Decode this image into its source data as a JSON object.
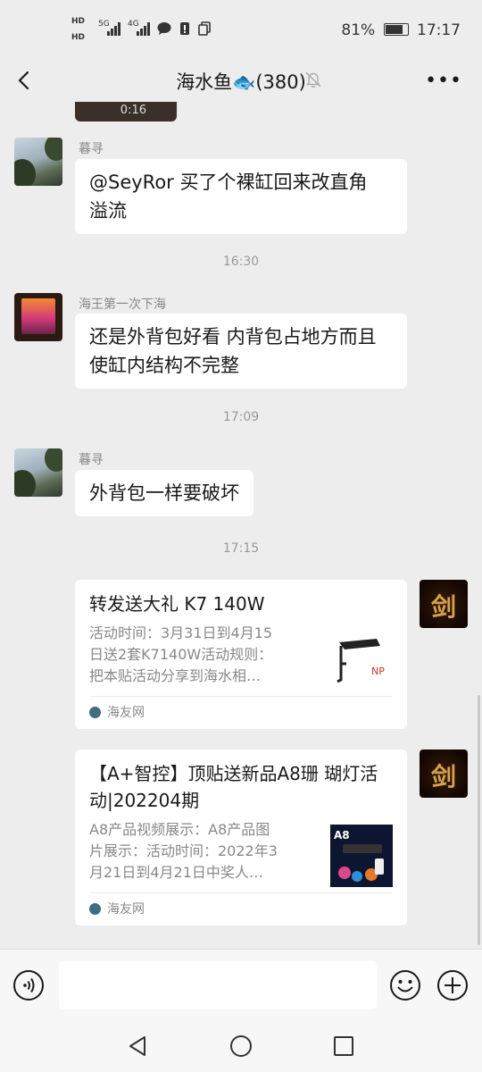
{
  "status_bar": {
    "hd1": "HD",
    "hd2": "HD",
    "net1": "5G",
    "net2": "4G",
    "battery": "81%",
    "time": "17:17"
  },
  "header": {
    "title": "海水鱼🐟(380)",
    "back_icon": "chevron-left-icon",
    "mute_icon": "bell-off-icon",
    "more_label": "•••"
  },
  "messages": [
    {
      "type": "video",
      "duration": "0:16"
    },
    {
      "type": "text",
      "sender": "暮寻",
      "avatar": "tree",
      "lines": [
        "@SeyRor  买了个裸缸回来改直角",
        "溢流"
      ]
    },
    {
      "type": "time",
      "text": "16:30"
    },
    {
      "type": "text",
      "sender": "海王第一次下海",
      "avatar": "sea",
      "lines": [
        "还是外背包好看 内背包占地方而且",
        "使缸内结构不完整"
      ]
    },
    {
      "type": "time",
      "text": "17:09"
    },
    {
      "type": "text",
      "sender": "暮寻",
      "avatar": "tree",
      "lines": [
        "外背包一样要破坏"
      ]
    },
    {
      "type": "time",
      "text": "17:15"
    },
    {
      "type": "card",
      "title": "转发送大礼 K7 140W",
      "desc": [
        "活动时间：3月31日到4月15",
        "日送2套K7140W活动规则：",
        "把本贴活动分享到海水相…"
      ],
      "source": "海友网",
      "thumb_label": "NP"
    },
    {
      "type": "card",
      "title": "【A+智控】顶贴送新品A8珊 瑚灯活动|202204期",
      "desc": [
        "A8产品视频展示：A8产品图",
        "片展示：活动时间：2022年3",
        "月21日到4月21日中奖人…"
      ],
      "source": "海友网",
      "thumb_label": "A8"
    }
  ],
  "input_bar": {
    "voice_icon": "voice-icon",
    "emoji_icon": "emoji-icon",
    "add_icon": "plus-circle-icon",
    "text_value": ""
  },
  "nav_bar": {
    "back_icon": "nav-back-icon",
    "home_icon": "nav-home-icon",
    "recent_icon": "nav-recent-icon"
  },
  "colors": {
    "background": "#ededed",
    "bubble": "#ffffff",
    "secondary_text": "#888888"
  }
}
